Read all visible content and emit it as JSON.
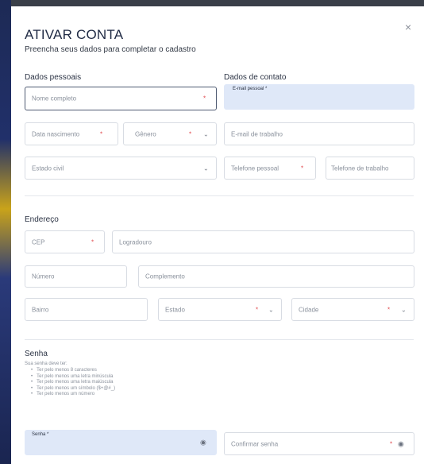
{
  "header": {
    "title": "ATIVAR CONTA",
    "subtitle": "Preencha seus dados para completar o cadastro",
    "close": "×"
  },
  "sections": {
    "personal": "Dados pessoais",
    "contact": "Dados de contato",
    "address": "Endereço",
    "password": "Senha"
  },
  "personal": {
    "full_name": "Nome completo",
    "birth_date": "Data nascimento",
    "gender": "Gênero",
    "marital_status": "Estado civil"
  },
  "contact": {
    "personal_email_label": "E-mail pessoal *",
    "work_email": "E-mail de trabalho",
    "personal_phone": "Telefone pessoal",
    "work_phone": "Telefone de trabalho"
  },
  "address": {
    "cep": "CEP",
    "street": "Logradouro",
    "number": "Número",
    "complement": "Complemento",
    "neighborhood": "Bairro",
    "state": "Estado",
    "city": "Cidade"
  },
  "password": {
    "intro": "Sua senha deve ter:",
    "rules": [
      "Ter pelo menos 8 caracteres",
      "Ter pelo menos uma letra minúscula",
      "Ter pelo menos uma letra maiúscula",
      "Ter pelo menos um símbolo ($+@#_)",
      "Ter pelo menos um número"
    ],
    "password_label": "Senha *",
    "confirm": "Confirmar senha"
  },
  "symbols": {
    "required": "*",
    "chevron": "⌄",
    "eye": "◉"
  },
  "colors": {
    "accent_border": "#4f5b72",
    "filled_bg": "#dfe8f8",
    "required": "#e0484c"
  }
}
